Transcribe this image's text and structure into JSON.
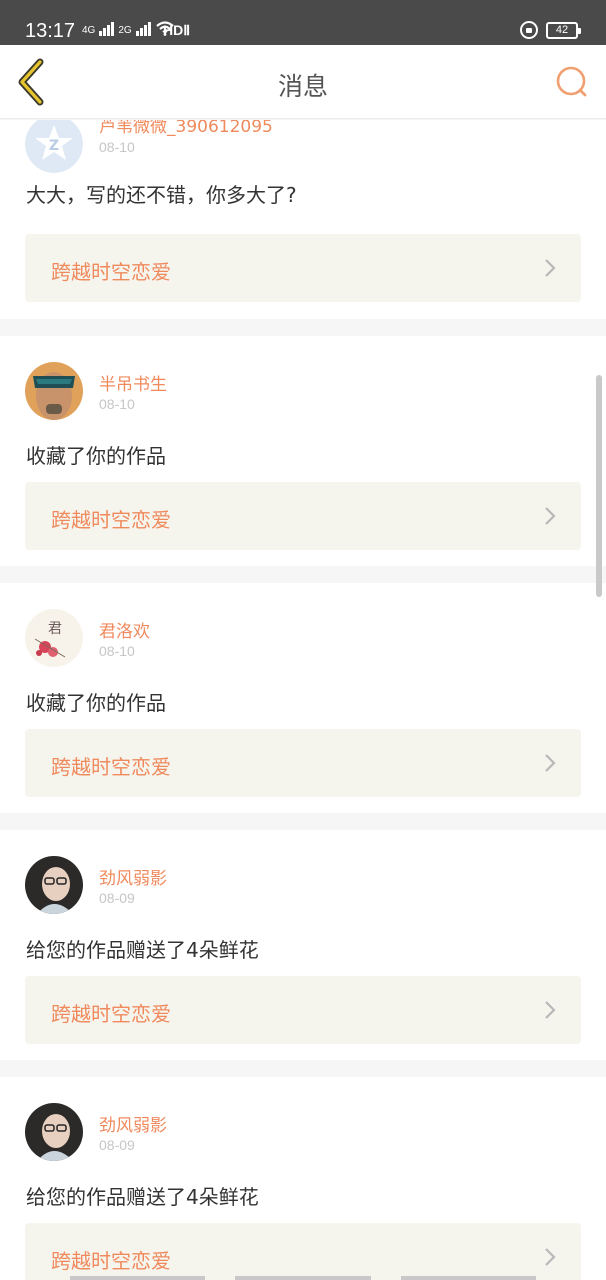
{
  "status_bar": {
    "time": "13:17",
    "net1": "4G",
    "net2": "2G",
    "hd": "HDⅡ",
    "battery": "42",
    "icons": [
      "signal-icon",
      "wifi-icon",
      "lock-rotation-icon",
      "battery-icon"
    ]
  },
  "header": {
    "title": "消息",
    "back_icon": "back-chevron-icon",
    "search_icon": "search-icon",
    "accent_color": "#f08a5d"
  },
  "messages": [
    {
      "username": "芦苇微微_390612095",
      "date": "08-10",
      "text": "大大，写的还不错，你多大了?",
      "work": "跨越时空恋爱",
      "avatar": "qq-default-avatar"
    },
    {
      "username": "半吊书生",
      "date": "08-10",
      "text": "收藏了你的作品",
      "work": "跨越时空恋爱",
      "avatar": "man-sunglasses-avatar"
    },
    {
      "username": "君洛欢",
      "date": "08-10",
      "text": "收藏了你的作品",
      "work": "跨越时空恋爱",
      "avatar": "flower-calligraphy-avatar"
    },
    {
      "username": "劲风弱影",
      "date": "08-09",
      "text": "给您的作品赠送了4朵鲜花",
      "work": "跨越时空恋爱",
      "avatar": "woman-glasses-avatar"
    },
    {
      "username": "劲风弱影",
      "date": "08-09",
      "text": "给您的作品赠送了4朵鲜花",
      "work": "跨越时空恋爱",
      "avatar": "woman-glasses-avatar"
    }
  ]
}
